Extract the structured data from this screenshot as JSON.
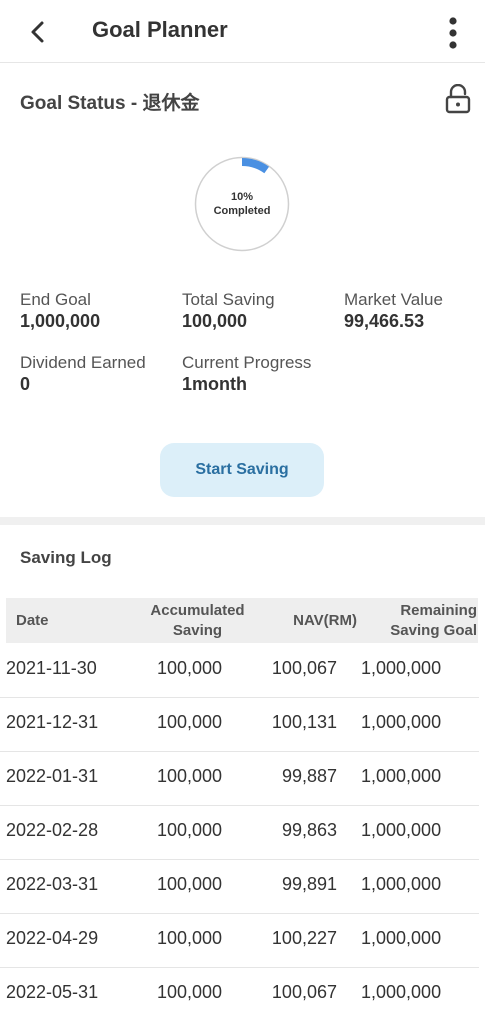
{
  "header": {
    "title": "Goal Planner"
  },
  "goal_status": {
    "title": "Goal Status - 退休金",
    "progress_percent": 10,
    "progress_text": "10%",
    "completed_label": "Completed"
  },
  "stats": {
    "end_goal": {
      "label": "End Goal",
      "value": "1,000,000"
    },
    "total_saving": {
      "label": "Total Saving",
      "value": "100,000"
    },
    "market_value": {
      "label": "Market Value",
      "value": "99,466.53"
    },
    "dividend": {
      "label": "Dividend Earned",
      "value": "0"
    },
    "current_progress": {
      "label": "Current Progress",
      "value": "1month"
    }
  },
  "start_button": "Start Saving",
  "saving_log": {
    "title": "Saving Log",
    "columns": {
      "date": "Date",
      "accumulated_1": "Accumulated",
      "accumulated_2": "Saving",
      "nav": "NAV(RM)",
      "remaining_1": "Remaining",
      "remaining_2": "Saving Goal"
    },
    "rows": [
      {
        "date": "2021-11-30",
        "accumulated": "100,000",
        "nav": "100,067",
        "remaining": "1,000,000"
      },
      {
        "date": "2021-12-31",
        "accumulated": "100,000",
        "nav": "100,131",
        "remaining": "1,000,000"
      },
      {
        "date": "2022-01-31",
        "accumulated": "100,000",
        "nav": "99,887",
        "remaining": "1,000,000"
      },
      {
        "date": "2022-02-28",
        "accumulated": "100,000",
        "nav": "99,863",
        "remaining": "1,000,000"
      },
      {
        "date": "2022-03-31",
        "accumulated": "100,000",
        "nav": "99,891",
        "remaining": "1,000,000"
      },
      {
        "date": "2022-04-29",
        "accumulated": "100,000",
        "nav": "100,227",
        "remaining": "1,000,000"
      },
      {
        "date": "2022-05-31",
        "accumulated": "100,000",
        "nav": "100,067",
        "remaining": "1,000,000"
      }
    ]
  },
  "colors": {
    "accent": "#4a90e2",
    "button_bg": "#dceff9",
    "button_text": "#2a6fa1"
  },
  "icons": {
    "back": "chevron-left-icon",
    "more": "more-vertical-icon",
    "lock": "unlock-icon"
  }
}
